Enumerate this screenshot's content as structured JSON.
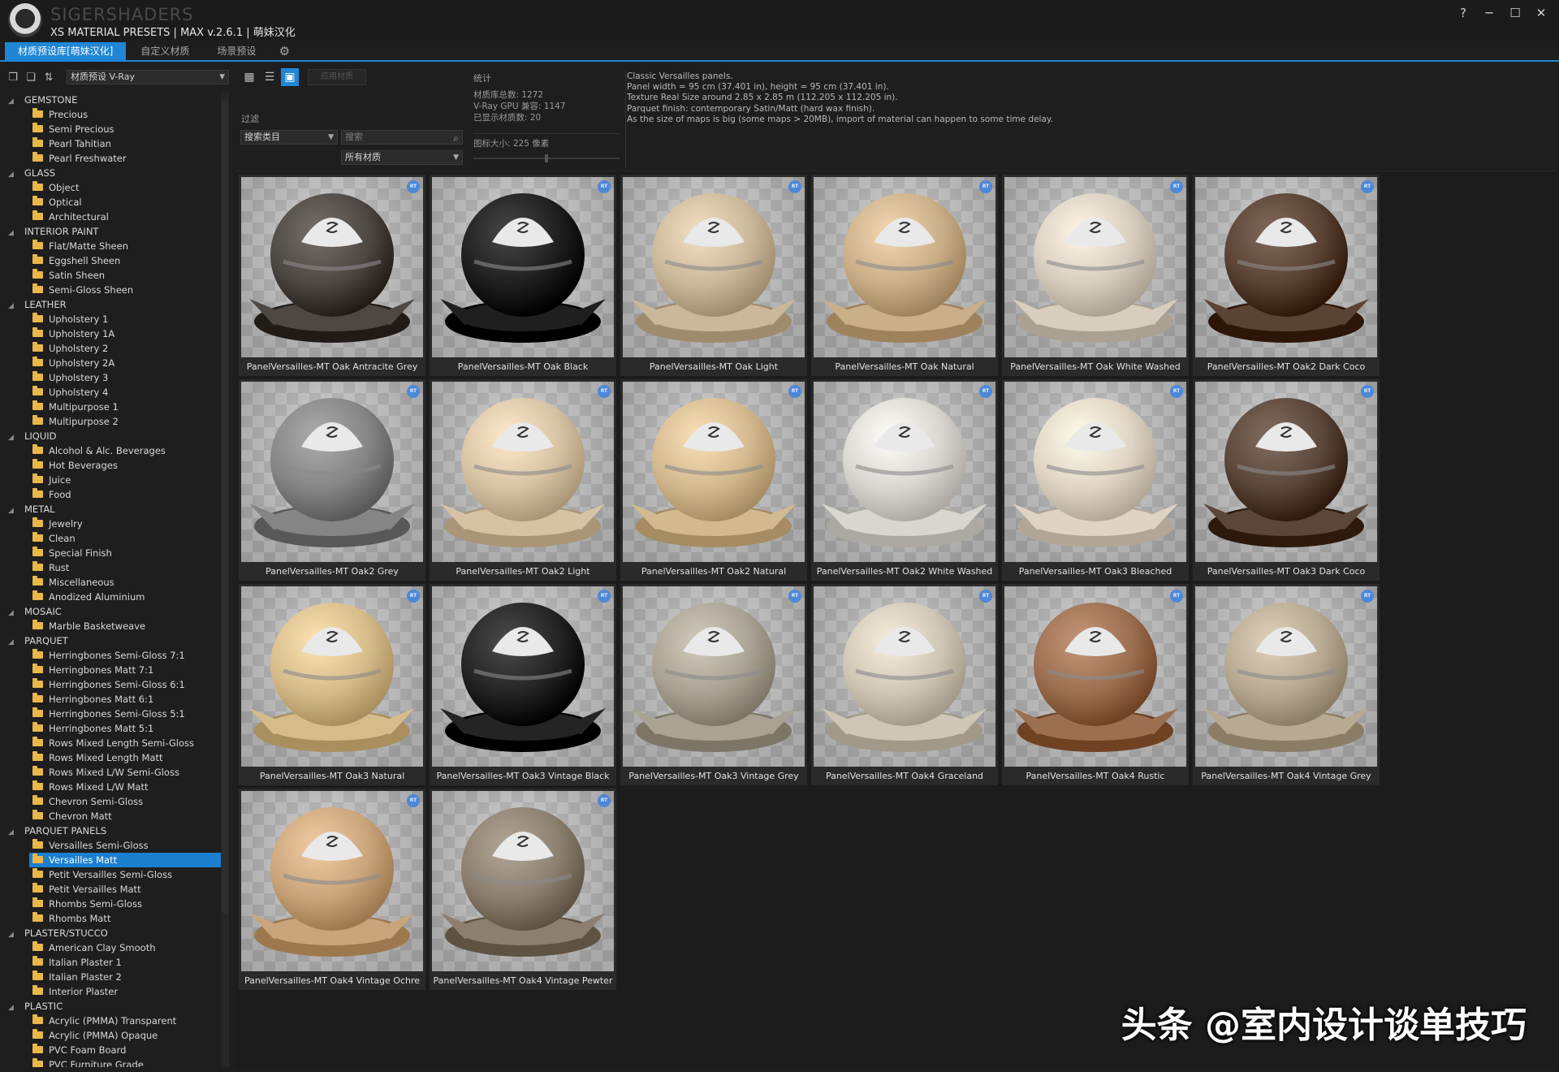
{
  "app": {
    "brand": "SIGERSHADERS",
    "title": "XS MATERIAL PRESETS | MAX v.2.6.1 | 萌妹汉化",
    "window_buttons": {
      "help": "?",
      "minimize": "─",
      "maximize": "☐",
      "close": "✕"
    }
  },
  "tabs": [
    {
      "label": "材质预设库[萌妹汉化]",
      "active": true
    },
    {
      "label": "自定义材质",
      "active": false
    },
    {
      "label": "场景预设",
      "active": false
    }
  ],
  "left": {
    "preset_select": "材质预设 V-Ray",
    "tree": [
      {
        "label": "GEMSTONE",
        "children": [
          "Precious",
          "Semi Precious",
          "Pearl Tahitian",
          "Pearl Freshwater"
        ]
      },
      {
        "label": "GLASS",
        "children": [
          "Object",
          "Optical",
          "Architectural"
        ]
      },
      {
        "label": "INTERIOR PAINT",
        "children": [
          "Flat/Matte Sheen",
          "Eggshell Sheen",
          "Satin Sheen",
          "Semi-Gloss Sheen"
        ]
      },
      {
        "label": "LEATHER",
        "children": [
          "Upholstery 1",
          "Upholstery 1A",
          "Upholstery 2",
          "Upholstery 2A",
          "Upholstery 3",
          "Upholstery 4",
          "Multipurpose 1",
          "Multipurpose 2"
        ]
      },
      {
        "label": "LIQUID",
        "children": [
          "Alcohol & Alc. Beverages",
          "Hot Beverages",
          "Juice",
          "Food"
        ]
      },
      {
        "label": "METAL",
        "children": [
          "Jewelry",
          "Clean",
          "Special Finish",
          "Rust",
          "Miscellaneous",
          "Anodized Aluminium"
        ]
      },
      {
        "label": "MOSAIC",
        "children": [
          "Marble Basketweave"
        ]
      },
      {
        "label": "PARQUET",
        "children": [
          "Herringbones Semi-Gloss 7:1",
          "Herringbones Matt 7:1",
          "Herringbones Semi-Gloss 6:1",
          "Herringbones Matt 6:1",
          "Herringbones Semi-Gloss 5:1",
          "Herringbones Matt 5:1",
          "Rows Mixed Length Semi-Gloss",
          "Rows Mixed Length Matt",
          "Rows Mixed L/W Semi-Gloss",
          "Rows Mixed L/W Matt",
          "Chevron Semi-Gloss",
          "Chevron Matt"
        ]
      },
      {
        "label": "PARQUET PANELS",
        "children": [
          "Versailles Semi-Gloss",
          "Versailles Matt",
          "Petit Versailles Semi-Gloss",
          "Petit Versailles Matt",
          "Rhombs Semi-Gloss",
          "Rhombs Matt"
        ]
      },
      {
        "label": "PLASTER/STUCCO",
        "children": [
          "American Clay Smooth",
          "Italian Plaster 1",
          "Italian Plaster 2",
          "Interior Plaster"
        ]
      },
      {
        "label": "PLASTIC",
        "children": [
          "Acrylic (PMMA) Transparent",
          "Acrylic (PMMA) Opaque",
          "PVC Foam Board",
          "PVC Furniture Grade"
        ]
      }
    ],
    "selected": "Versailles Matt"
  },
  "controls": {
    "apply_label": "应用材质",
    "filter_label": "过滤",
    "search_category": "搜索类目",
    "search_placeholder": "搜索",
    "material_filter": "所有材质"
  },
  "stats": {
    "title": "统计",
    "total": "材质库总数: 1272",
    "gpu": "V-Ray GPU 兼容: 1147",
    "shown": "已显示材质数: 20",
    "icon_size": "图标大小: 225 像素",
    "icon_size_fraction": 0.5
  },
  "description": [
    "Classic Versailles panels.",
    "Panel width = 95 cm (37.401 in), height = 95 cm (37.401 in).",
    "Texture Real Size around 2.85 x 2.85 m (112.205 x 112.205 in).",
    "Parquet finish: contemporary Satin/Matt (hard wax finish).",
    "As the size of maps is big (some maps > 20MB), import of material can happen to some time delay."
  ],
  "badge_label": "RT",
  "materials": [
    {
      "name": "PanelVersailles-MT Oak Antracite Grey",
      "color": "#4e4843"
    },
    {
      "name": "PanelVersailles-MT Oak Black",
      "color": "#1f1f1f"
    },
    {
      "name": "PanelVersailles-MT Oak Light",
      "color": "#cbb89a"
    },
    {
      "name": "PanelVersailles-MT Oak Natural",
      "color": "#caaf88"
    },
    {
      "name": "PanelVersailles-MT Oak White Washed",
      "color": "#d8cebf"
    },
    {
      "name": "PanelVersailles-MT Oak2 Dark Coco",
      "color": "#5a4234"
    },
    {
      "name": "PanelVersailles-MT Oak2 Grey",
      "color": "#858585"
    },
    {
      "name": "PanelVersailles-MT Oak2 Light",
      "color": "#d7c2a4"
    },
    {
      "name": "PanelVersailles-MT Oak2 Natural",
      "color": "#d3b98f"
    },
    {
      "name": "PanelVersailles-MT Oak2 White Washed",
      "color": "#d9d6d0"
    },
    {
      "name": "PanelVersailles-MT Oak3 Bleached",
      "color": "#dfd4c3"
    },
    {
      "name": "PanelVersailles-MT Oak3 Dark Coco",
      "color": "#5b463a"
    },
    {
      "name": "PanelVersailles-MT Oak3 Natural",
      "color": "#d6bc8b"
    },
    {
      "name": "PanelVersailles-MT Oak3 Vintage Black",
      "color": "#242424"
    },
    {
      "name": "PanelVersailles-MT Oak3 Vintage Grey",
      "color": "#aaa394"
    },
    {
      "name": "PanelVersailles-MT Oak4 Graceland",
      "color": "#cfc6b5"
    },
    {
      "name": "PanelVersailles-MT Oak4 Rustic",
      "color": "#9b6f50"
    },
    {
      "name": "PanelVersailles-MT Oak4 Vintage Grey",
      "color": "#b8a993"
    },
    {
      "name": "PanelVersailles-MT Oak4 Vintage Ochre",
      "color": "#caa57c"
    },
    {
      "name": "PanelVersailles-MT Oak4 Vintage Pewter",
      "color": "#8d7f70"
    }
  ],
  "watermark": "头条 @室内设计谈单技巧",
  "colors": {
    "accent": "#1f86d6",
    "folder": "#e9b74a",
    "badge": "#4d88d8"
  }
}
